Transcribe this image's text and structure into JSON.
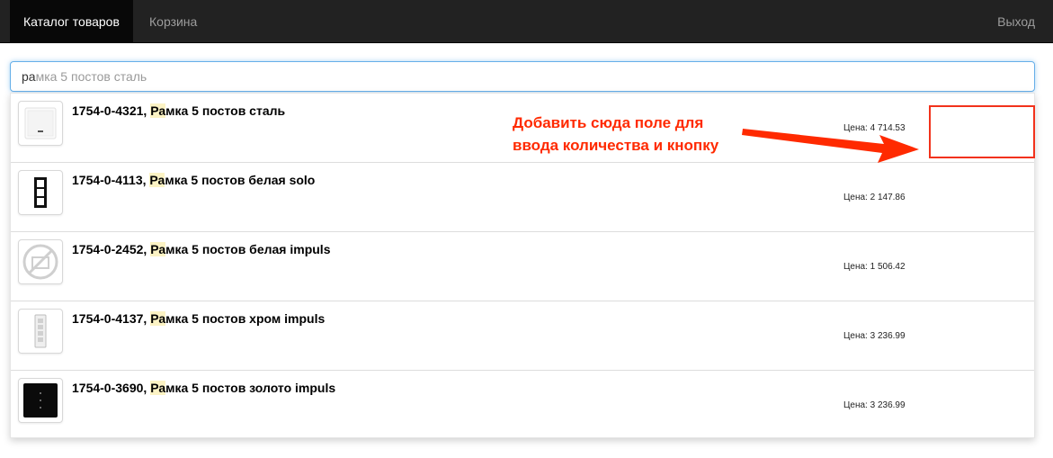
{
  "nav": {
    "catalog": "Каталог товаров",
    "cart": "Корзина",
    "logout": "Выход"
  },
  "search": {
    "typed": "ра",
    "hint": "мка 5 постов сталь"
  },
  "results": [
    {
      "code": "1754-0-4321, ",
      "hl": "Ра",
      "rest": "мка 5 постов сталь",
      "price": "Цена: 4 714.53",
      "thumb_icon": "white-frame-icon"
    },
    {
      "code": "1754-0-4113, ",
      "hl": "Ра",
      "rest": "мка 5 постов белая solo",
      "price": "Цена: 2 147.86",
      "thumb_icon": "black-triple-frame-icon"
    },
    {
      "code": "1754-0-2452, ",
      "hl": "Ра",
      "rest": "мка 5 постов белая impuls",
      "price": "Цена: 1 506.42",
      "thumb_icon": "no-image-icon"
    },
    {
      "code": "1754-0-4137, ",
      "hl": "Ра",
      "rest": "мка 5 постов хром impuls",
      "price": "Цена: 3 236.99",
      "thumb_icon": "chrome-vertical-frame-icon"
    },
    {
      "code": "1754-0-3690, ",
      "hl": "Ра",
      "rest": "мка 5 постов золото impuls",
      "price": "Цена: 3 236.99",
      "thumb_icon": "black-panel-icon"
    }
  ],
  "annotation": {
    "line1": "Добавить сюда поле для",
    "line2": "ввода количества и кнопку"
  },
  "colors": {
    "navbar": "#222222",
    "highlight": "#fcf3c4",
    "annotation": "#ff2a00"
  }
}
